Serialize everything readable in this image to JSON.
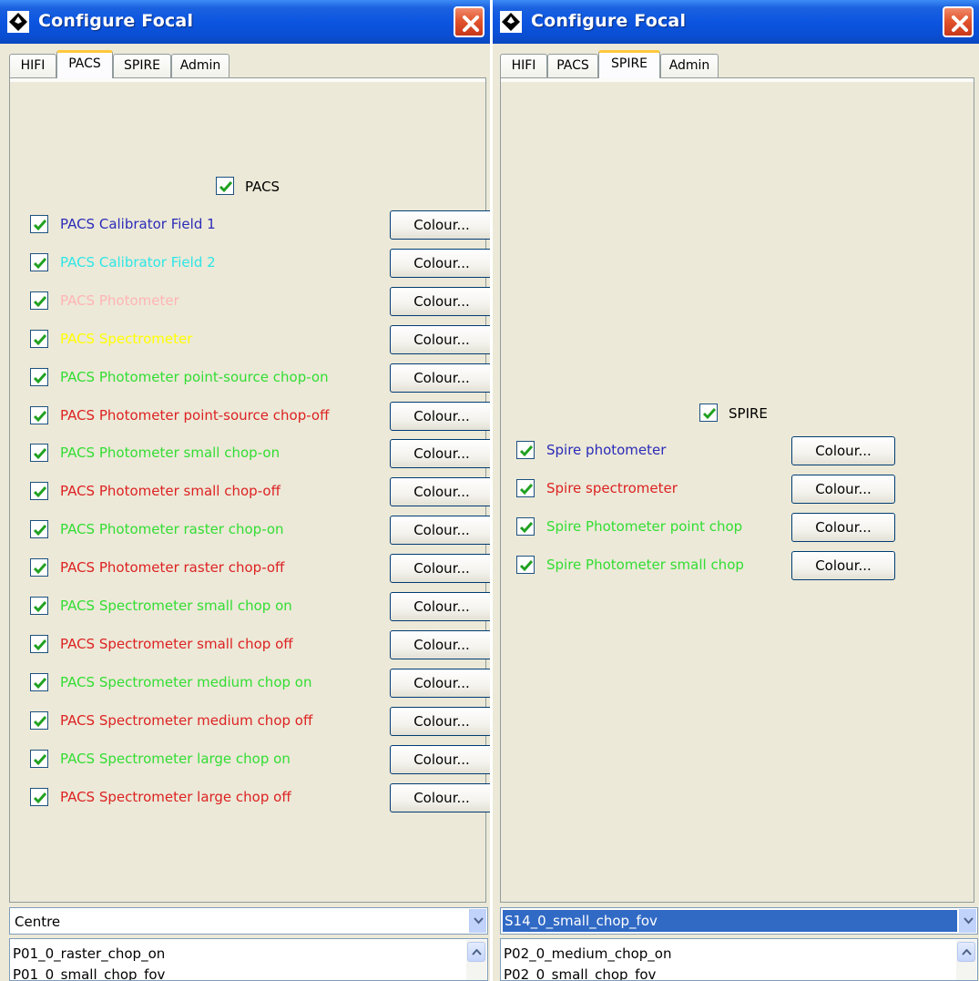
{
  "left_window": {
    "title": "Configure Focal",
    "tabs": [
      "HIFI",
      "PACS",
      "SPIRE",
      "Admin"
    ],
    "active_tab": "PACS",
    "master_checkbox": {
      "label": "PACS",
      "checked": true
    },
    "items": [
      {
        "label": "PACS Calibrator Field 1",
        "color": "#2b2bb8",
        "checked": true,
        "button": "Colour..."
      },
      {
        "label": "PACS Calibrator Field 2",
        "color": "#2ee6e6",
        "checked": true,
        "button": "Colour..."
      },
      {
        "label": "PACS Photometer",
        "color": "#ffb4b4",
        "checked": true,
        "button": "Colour..."
      },
      {
        "label": "PACS Spectrometer",
        "color": "#ffff00",
        "checked": true,
        "button": "Colour..."
      },
      {
        "label": "PACS Photometer point-source chop-on",
        "color": "#33dd33",
        "checked": true,
        "button": "Colour..."
      },
      {
        "label": "PACS Photometer point-source chop-off",
        "color": "#dd2222",
        "checked": true,
        "button": "Colour..."
      },
      {
        "label": "PACS Photometer small chop-on",
        "color": "#33dd33",
        "checked": true,
        "button": "Colour..."
      },
      {
        "label": "PACS Photometer small chop-off",
        "color": "#dd2222",
        "checked": true,
        "button": "Colour..."
      },
      {
        "label": "PACS Photometer raster chop-on",
        "color": "#33dd33",
        "checked": true,
        "button": "Colour..."
      },
      {
        "label": "PACS Photometer raster chop-off",
        "color": "#dd2222",
        "checked": true,
        "button": "Colour..."
      },
      {
        "label": "PACS Spectrometer small chop on",
        "color": "#33dd33",
        "checked": true,
        "button": "Colour..."
      },
      {
        "label": "PACS Spectrometer small chop off",
        "color": "#dd2222",
        "checked": true,
        "button": "Colour..."
      },
      {
        "label": "PACS Spectrometer medium chop on",
        "color": "#33dd33",
        "checked": true,
        "button": "Colour..."
      },
      {
        "label": "PACS Spectrometer medium chop off",
        "color": "#dd2222",
        "checked": true,
        "button": "Colour..."
      },
      {
        "label": "PACS Spectrometer large chop on",
        "color": "#33dd33",
        "checked": true,
        "button": "Colour..."
      },
      {
        "label": "PACS Spectrometer large chop off",
        "color": "#dd2222",
        "checked": true,
        "button": "Colour..."
      }
    ],
    "combo_value": "Centre",
    "list_items": [
      "P01_0_raster_chop_on",
      "P01_0_small_chop_fov"
    ]
  },
  "right_window": {
    "title": "Configure Focal",
    "tabs": [
      "HIFI",
      "PACS",
      "SPIRE",
      "Admin"
    ],
    "active_tab": "SPIRE",
    "master_checkbox": {
      "label": "SPIRE",
      "checked": true
    },
    "items": [
      {
        "label": "Spire photometer",
        "color": "#2b2bb8",
        "checked": true,
        "button": "Colour..."
      },
      {
        "label": "Spire spectrometer",
        "color": "#dd2222",
        "checked": true,
        "button": "Colour..."
      },
      {
        "label": "Spire Photometer point chop",
        "color": "#33dd33",
        "checked": true,
        "button": "Colour..."
      },
      {
        "label": "Spire Photometer small chop",
        "color": "#33dd33",
        "checked": true,
        "button": "Colour..."
      }
    ],
    "combo_value": "S14_0_small_chop_fov",
    "list_items": [
      "P02_0_medium_chop_on",
      "P02_0_small_chop_fov"
    ]
  },
  "colors": {
    "titlebar": "#0c55e0",
    "panel_bg": "#ece9d8",
    "checkmark": "#21a121",
    "selection": "#316ac5"
  }
}
